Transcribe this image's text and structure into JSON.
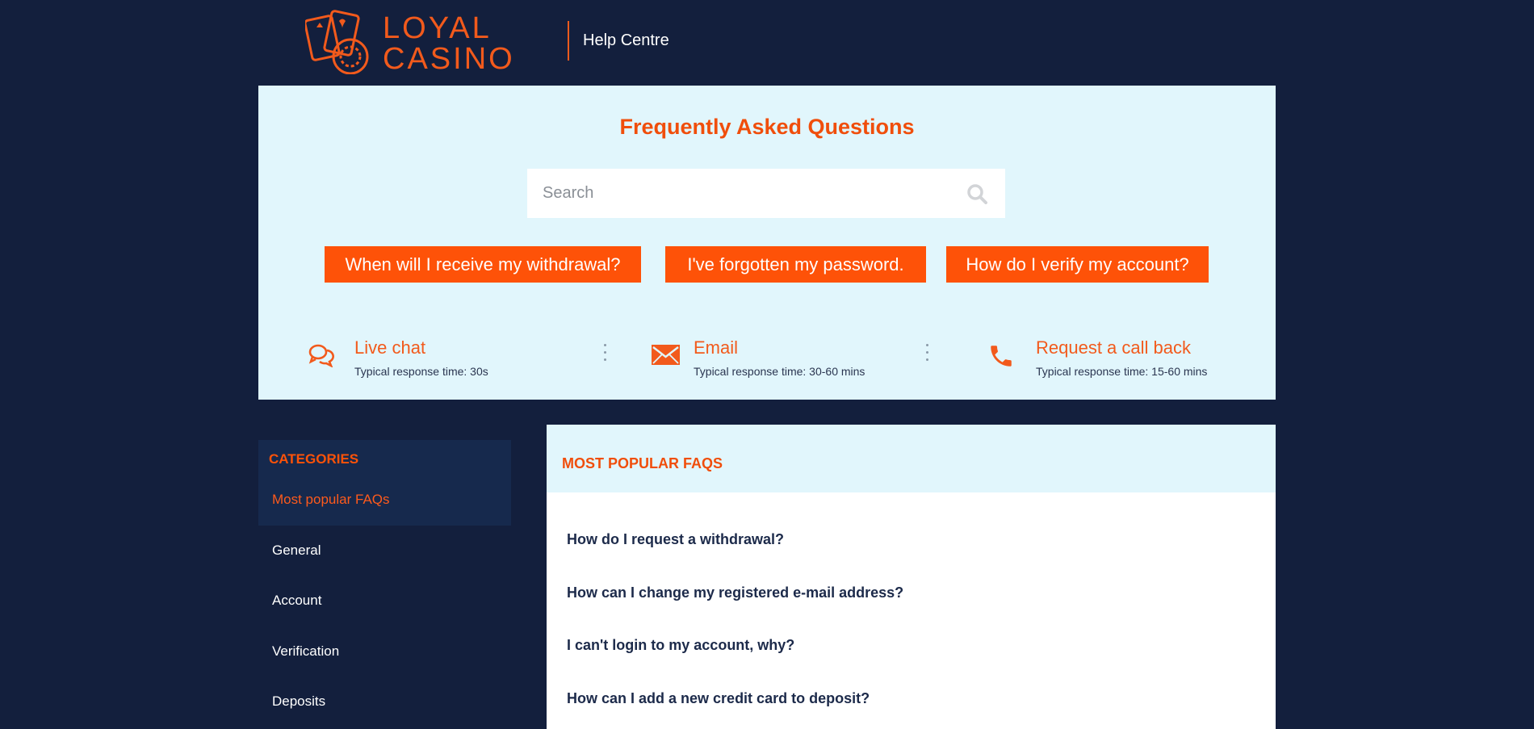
{
  "header": {
    "logo_line1": "LOYAL",
    "logo_line2": "CASINO",
    "section": "Help Centre"
  },
  "hero": {
    "title": "Frequently Asked Questions",
    "search_placeholder": "Search",
    "quick_links": [
      "When will I receive my withdrawal?",
      "I've forgotten my password.",
      "How do I verify my account?"
    ],
    "contacts": [
      {
        "title": "Live chat",
        "subtitle": "Typical response time: 30s",
        "icon": "chat-icon"
      },
      {
        "title": "Email",
        "subtitle": "Typical response time: 30-60 mins",
        "icon": "email-icon"
      },
      {
        "title": "Request a call back",
        "subtitle": "Typical response time: 15-60 mins",
        "icon": "phone-icon"
      }
    ]
  },
  "sidebar": {
    "heading": "CATEGORIES",
    "items": [
      "Most popular FAQs",
      "General",
      "Account",
      "Verification",
      "Deposits"
    ]
  },
  "main": {
    "heading": "MOST POPULAR FAQS",
    "faqs": [
      "How do I request a withdrawal?",
      "How can I change my registered e-mail address?",
      "I can't login to my account, why?",
      "How can I add a new credit card to deposit?"
    ]
  },
  "colors": {
    "background": "#131f3d",
    "accent": "#fe5208",
    "hero_bg": "#e1f6fc",
    "sidebar_active_bg": "#16294d"
  }
}
